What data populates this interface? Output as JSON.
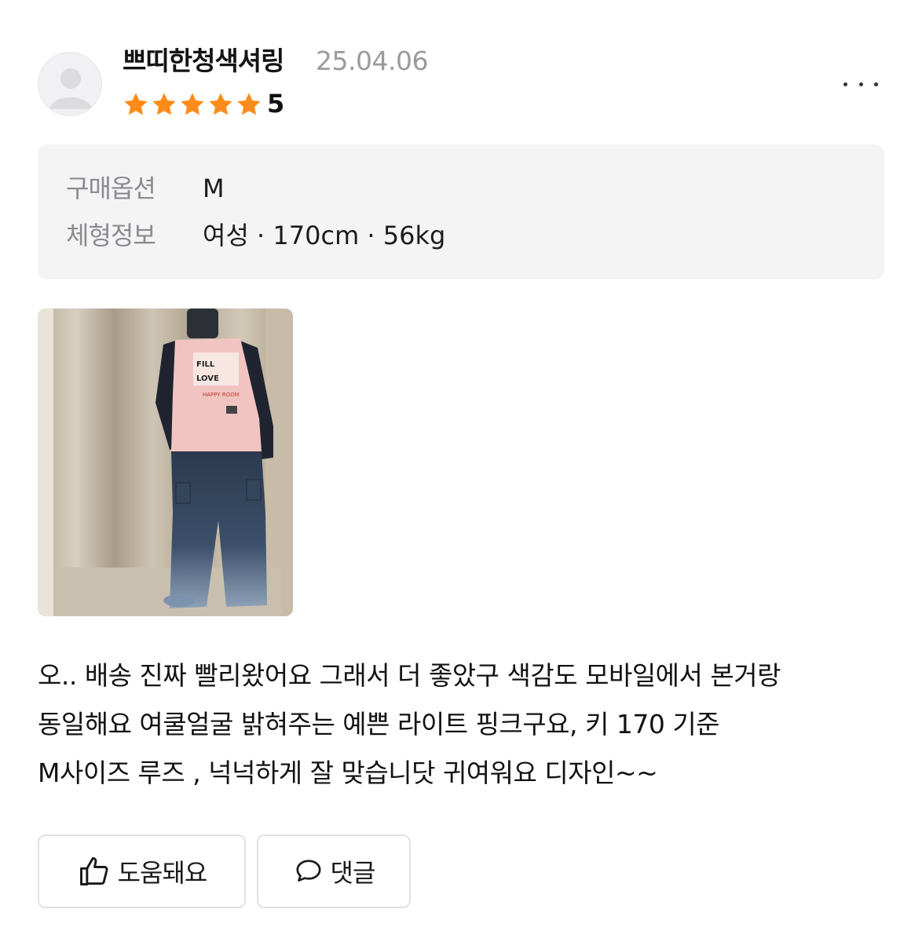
{
  "review": {
    "author": "쁘띠한청색셔링",
    "date": "25.04.06",
    "rating": "5",
    "star_color": "#FF8C1A",
    "more_icon": "ellipsis-icon",
    "purchase_option_label": "구매옵션",
    "purchase_option_value": "M",
    "body_info_label": "체형정보",
    "body_info_value": "여성 · 170cm · 56kg",
    "photo_description_icon": "review-photo",
    "text_lines": [
      "오.. 배송 진짜 빨리왔어요 그래서 더 좋았구 색감도 모바일에서 본거랑",
      "동일해요 여쿨얼굴 밝혀주는 예쁜 라이트 핑크구요, 키 170 기준",
      "M사이즈 루즈 , 넉넉하게 잘 맞습니닷 귀여워요 디자인~~"
    ]
  },
  "actions": {
    "helpful_label": "도움돼요",
    "helpful_icon": "thumbs-up-icon",
    "comment_label": "댓글",
    "comment_icon": "speech-bubble-icon"
  }
}
